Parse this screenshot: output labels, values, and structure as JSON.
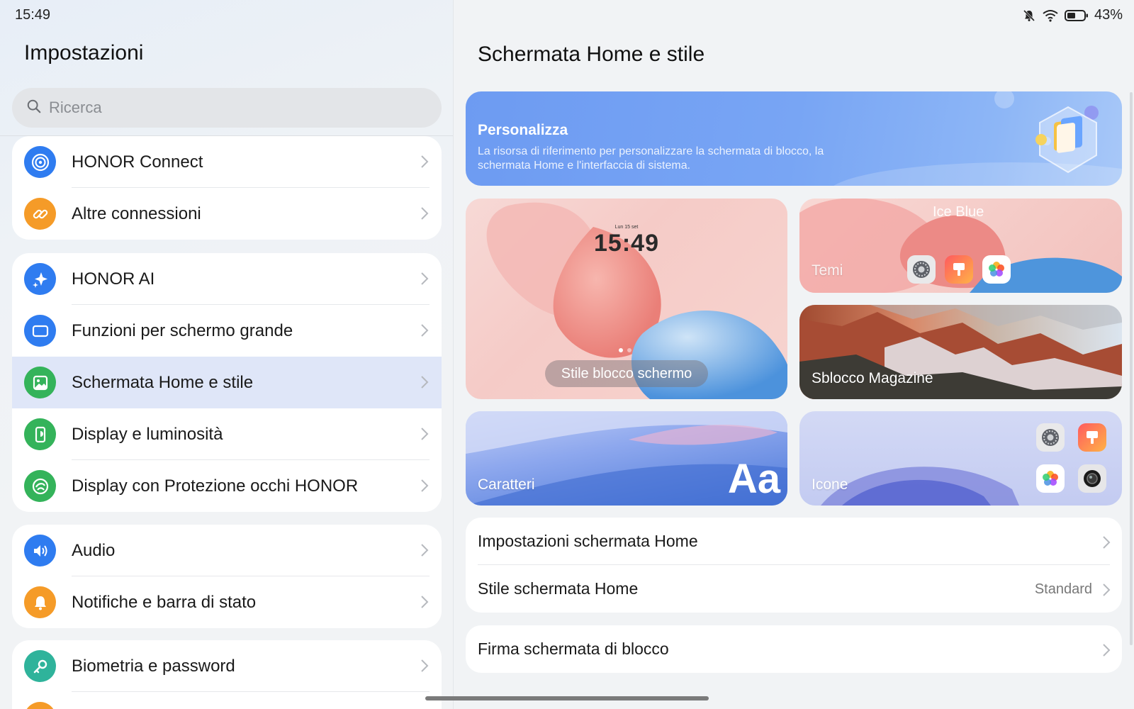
{
  "status": {
    "time": "15:49",
    "battery": "43%"
  },
  "left": {
    "title": "Impostazioni",
    "search_placeholder": "Ricerca",
    "groups": [
      [
        {
          "label": "HONOR Connect",
          "icon": "honor-connect-icon",
          "color": "#2f7cf0"
        },
        {
          "label": "Altre connessioni",
          "icon": "link-icon",
          "color": "#f59b28"
        }
      ],
      [
        {
          "label": "HONOR AI",
          "icon": "sparkle-icon",
          "color": "#2f7cf0"
        },
        {
          "label": "Funzioni per schermo grande",
          "icon": "tablet-icon",
          "color": "#2f7cf0"
        },
        {
          "label": "Schermata Home e stile",
          "icon": "image-icon",
          "color": "#34b35a",
          "active": true
        },
        {
          "label": "Display e luminosità",
          "icon": "display-brightness-icon",
          "color": "#34b35a"
        },
        {
          "label": "Display con Protezione occhi HONOR",
          "icon": "eye-comfort-icon",
          "color": "#34b35a"
        }
      ],
      [
        {
          "label": "Audio",
          "icon": "speaker-icon",
          "color": "#2f7cf0"
        },
        {
          "label": "Notifiche e barra di stato",
          "icon": "bell-icon",
          "color": "#f59b28"
        }
      ],
      [
        {
          "label": "Biometria e password",
          "icon": "key-icon",
          "color": "#2fb39b"
        }
      ]
    ]
  },
  "right": {
    "title": "Schermata Home e stile",
    "banner": {
      "title": "Personalizza",
      "subtitle": "La risorsa di riferimento per personalizzare la schermata di blocco, la schermata Home e l'interfaccia di sistema."
    },
    "cards": {
      "lockscreen": {
        "label": "Stile blocco schermo",
        "clock": "15:49",
        "date": "Lun 15 set"
      },
      "themes": {
        "label": "Temi",
        "theme_name": "Ice Blue"
      },
      "magazine": {
        "label": "Sblocco Magazine"
      },
      "fonts": {
        "label": "Caratteri",
        "sample": "Aa"
      },
      "icons": {
        "label": "Icone"
      }
    },
    "list1": [
      {
        "label": "Impostazioni schermata Home",
        "value": ""
      },
      {
        "label": "Stile schermata Home",
        "value": "Standard"
      }
    ],
    "list2": [
      {
        "label": "Firma schermata di blocco",
        "value": ""
      }
    ]
  },
  "colors": {
    "accent": "#2f7cf0",
    "active_row": "#dfe6f8",
    "banner": "#78a5f4"
  }
}
